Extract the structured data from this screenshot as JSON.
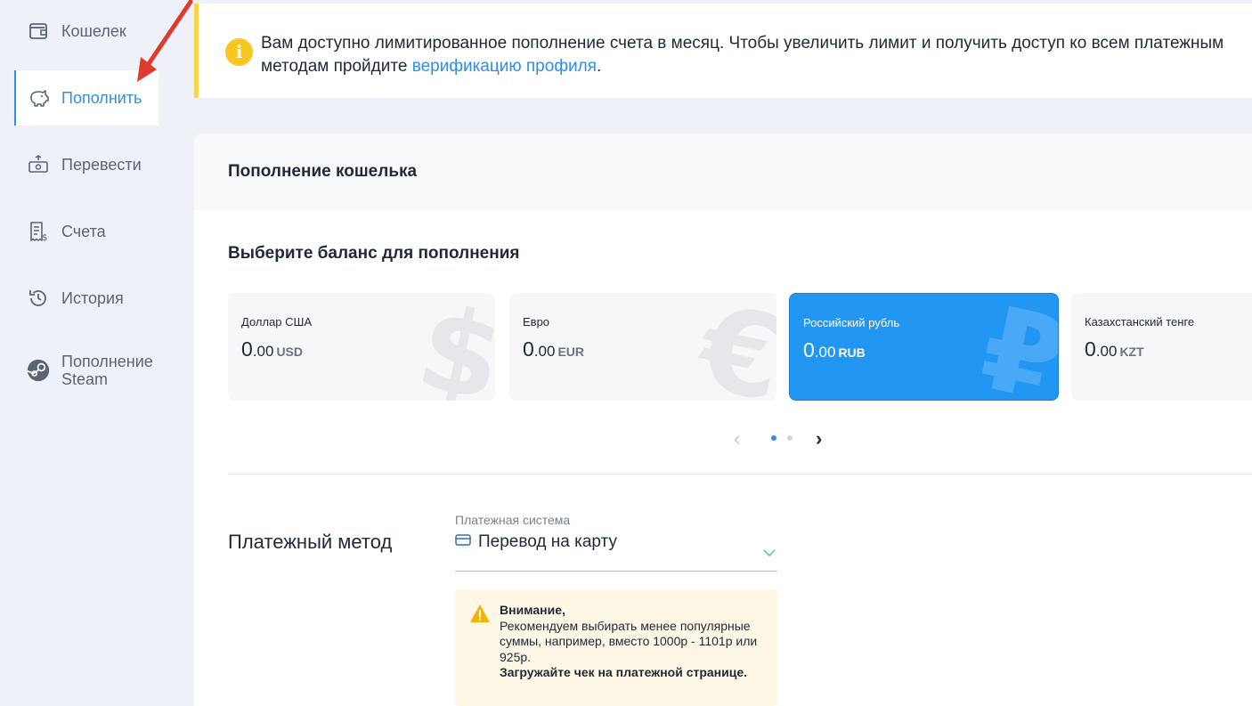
{
  "sidebar": {
    "items": [
      {
        "label": "Кошелек",
        "icon": "wallet-icon"
      },
      {
        "label": "Пополнить",
        "icon": "piggy-bank-icon",
        "active": true
      },
      {
        "label": "Перевести",
        "icon": "money-transfer-icon"
      },
      {
        "label": "Счета",
        "icon": "invoice-icon"
      },
      {
        "label": "История",
        "icon": "history-icon"
      },
      {
        "label": "Пополнение Steam",
        "icon": "steam-icon"
      }
    ]
  },
  "notice": {
    "text_before": "Вам доступно лимитированное пополнение счета в месяц. Чтобы увеличить лимит и получить доступ ко всем платежным",
    "text_line2": "методам пройдите ",
    "link": "верификацию профиля",
    "text_after": "."
  },
  "wallet_topup": {
    "title": "Пополнение кошелька",
    "choose_balance_title": "Выберите баланс для пополнения",
    "balances": [
      {
        "name": "Доллар США",
        "int": "0",
        "frac": ".00",
        "currency": "USD",
        "glyph": "$"
      },
      {
        "name": "Евро",
        "int": "0",
        "frac": ".00",
        "currency": "EUR",
        "glyph": "€"
      },
      {
        "name": "Российский рубль",
        "int": "0",
        "frac": ".00",
        "currency": "RUB",
        "glyph": "₽",
        "selected": true
      },
      {
        "name": "Казахстанский тенге",
        "int": "0",
        "frac": ".00",
        "currency": "KZT",
        "glyph": "₸"
      }
    ],
    "pager": {
      "pages": 2,
      "current": 1
    }
  },
  "payment": {
    "method_label": "Платежный метод",
    "system_caption": "Платежная система",
    "system_value": "Перевод на карту"
  },
  "warning": {
    "title": "Внимание,",
    "body": "Рекомендуем выбирать менее популярные суммы, например, вместо 1000р - 1101р или 925р.",
    "bold_tail": "Загружайте чек на платежной странице."
  },
  "colors": {
    "accent": "#2f8ee6",
    "selected_card": "#2196f3",
    "notice_bar": "#fcd34d",
    "info_icon": "#f8c61f",
    "warning_bg": "#fef7e6",
    "annotation_arrow": "#e03a2f"
  }
}
